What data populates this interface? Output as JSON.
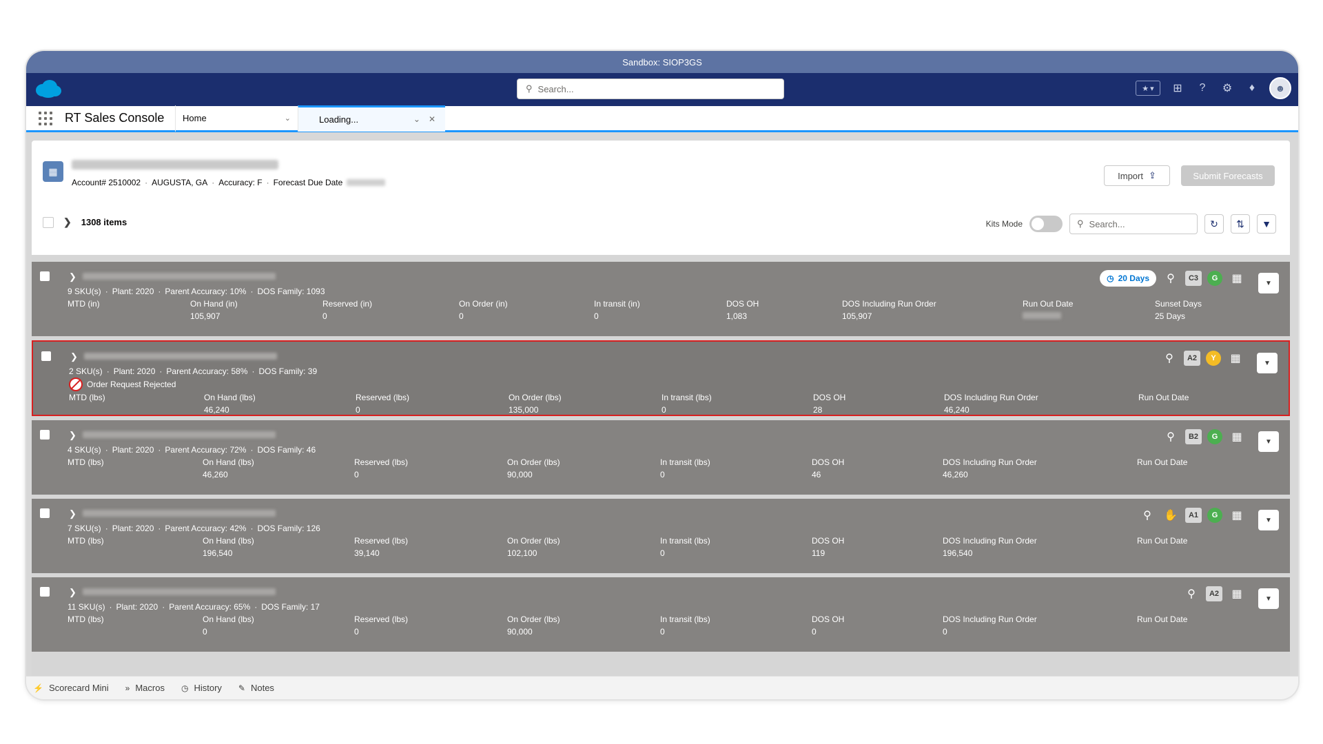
{
  "window": {
    "sandbox_label": "Sandbox: SIOP3GS"
  },
  "global_header": {
    "search_placeholder": "Search..."
  },
  "tabs": {
    "app_name": "RT Sales Console",
    "home_label": "Home",
    "loading_label": "Loading..."
  },
  "account": {
    "account_number": "Account# 2510002",
    "location": "AUGUSTA, GA",
    "accuracy": "Accuracy: F",
    "forecast_due_label": "Forecast Due Date"
  },
  "actions": {
    "import_label": "Import",
    "submit_label": "Submit Forecasts"
  },
  "list": {
    "items_count": "1308 items",
    "kits_mode_label": "Kits Mode",
    "search_placeholder": "Search..."
  },
  "rows": [
    {
      "meta": [
        "9 SKU(s)",
        "Plant: 2020",
        "Parent Accuracy: 10%",
        "DOS Family: 1093"
      ],
      "rejected_text": "",
      "metrics": [
        {
          "label": "MTD (in)",
          "value": ""
        },
        {
          "label": "On Hand (in)",
          "value": "105,907"
        },
        {
          "label": "Reserved (in)",
          "value": "0"
        },
        {
          "label": "On Order (in)",
          "value": "0"
        },
        {
          "label": "In transit (in)",
          "value": "0"
        },
        {
          "label": "DOS OH",
          "value": "1,083"
        },
        {
          "label": "DOS Including Run Order",
          "value": "105,907"
        },
        {
          "label": "Run Out Date",
          "value": ""
        },
        {
          "label": "Sunset Days",
          "value": "25 Days"
        }
      ],
      "badges": {
        "days": "20 Days",
        "code": "C3",
        "grade": "G",
        "grade_color": "#4caf50"
      }
    },
    {
      "meta": [
        "2 SKU(s)",
        "Plant: 2020",
        "Parent Accuracy: 58%",
        "DOS Family: 39"
      ],
      "rejected_text": "Order Request Rejected",
      "metrics": [
        {
          "label": "MTD (lbs)",
          "value": ""
        },
        {
          "label": "On Hand (lbs)",
          "value": "46,240"
        },
        {
          "label": "Reserved (lbs)",
          "value": "0"
        },
        {
          "label": "On Order (lbs)",
          "value": "135,000"
        },
        {
          "label": "In transit (lbs)",
          "value": "0"
        },
        {
          "label": "DOS OH",
          "value": "28"
        },
        {
          "label": "DOS Including Run Order",
          "value": "46,240"
        },
        {
          "label": "Run Out Date",
          "value": ""
        }
      ],
      "badges": {
        "code": "A2",
        "grade": "Y",
        "grade_color": "#f4bc25"
      }
    },
    {
      "meta": [
        "4 SKU(s)",
        "Plant: 2020",
        "Parent Accuracy: 72%",
        "DOS Family: 46"
      ],
      "rejected_text": "",
      "metrics": [
        {
          "label": "MTD (lbs)",
          "value": ""
        },
        {
          "label": "On Hand (lbs)",
          "value": "46,260"
        },
        {
          "label": "Reserved (lbs)",
          "value": "0"
        },
        {
          "label": "On Order (lbs)",
          "value": "90,000"
        },
        {
          "label": "In transit (lbs)",
          "value": "0"
        },
        {
          "label": "DOS OH",
          "value": "46"
        },
        {
          "label": "DOS Including Run Order",
          "value": "46,260"
        },
        {
          "label": "Run Out Date",
          "value": ""
        }
      ],
      "badges": {
        "code": "B2",
        "grade": "G",
        "grade_color": "#4caf50"
      }
    },
    {
      "meta": [
        "7 SKU(s)",
        "Plant: 2020",
        "Parent Accuracy: 42%",
        "DOS Family: 126"
      ],
      "rejected_text": "",
      "metrics": [
        {
          "label": "MTD (lbs)",
          "value": ""
        },
        {
          "label": "On Hand (lbs)",
          "value": "196,540"
        },
        {
          "label": "Reserved (lbs)",
          "value": "39,140"
        },
        {
          "label": "On Order (lbs)",
          "value": "102,100"
        },
        {
          "label": "In transit (lbs)",
          "value": "0"
        },
        {
          "label": "DOS OH",
          "value": "119"
        },
        {
          "label": "DOS Including Run Order",
          "value": "196,540"
        },
        {
          "label": "Run Out Date",
          "value": ""
        }
      ],
      "badges": {
        "code": "A1",
        "grade": "G",
        "grade_color": "#4caf50",
        "hand_icon": "hand-icon"
      }
    },
    {
      "meta": [
        "11 SKU(s)",
        "Plant: 2020",
        "Parent Accuracy: 65%",
        "DOS Family: 17"
      ],
      "rejected_text": "",
      "metrics": [
        {
          "label": "MTD (lbs)",
          "value": ""
        },
        {
          "label": "On Hand (lbs)",
          "value": "0"
        },
        {
          "label": "Reserved (lbs)",
          "value": "0"
        },
        {
          "label": "On Order (lbs)",
          "value": "90,000"
        },
        {
          "label": "In transit (lbs)",
          "value": "0"
        },
        {
          "label": "DOS OH",
          "value": "0"
        },
        {
          "label": "DOS Including Run Order",
          "value": "0"
        },
        {
          "label": "Run Out Date",
          "value": ""
        }
      ],
      "badges": {
        "code": "A2"
      }
    }
  ],
  "utility_bar": {
    "items": [
      "Scorecard Mini",
      "Macros",
      "History",
      "Notes"
    ]
  },
  "colors": {
    "header_navy": "#1b2e6e",
    "sandbox_blue": "#5d73a3",
    "accent_blue": "#1b96ff",
    "rejected_red": "#d72020"
  }
}
